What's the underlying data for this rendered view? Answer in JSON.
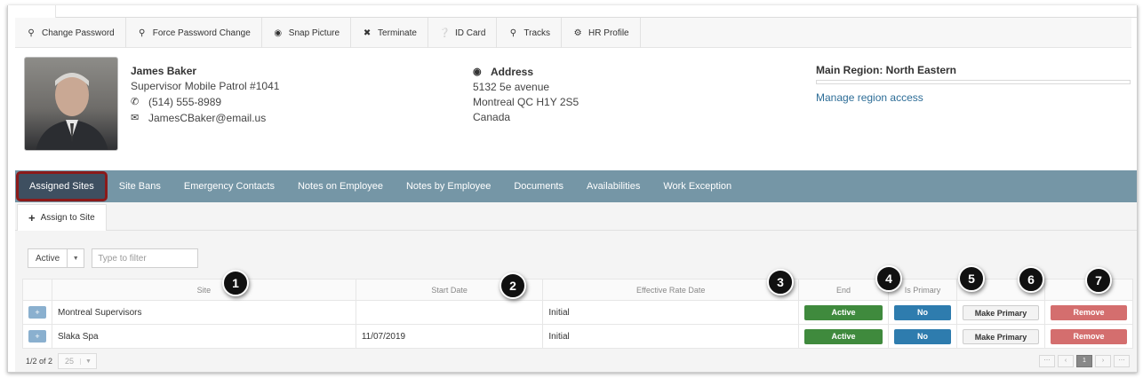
{
  "toolbar": {
    "items": [
      {
        "label": "Change Password",
        "icon": "key-icon"
      },
      {
        "label": "Force Password Change",
        "icon": "key-icon"
      },
      {
        "label": "Snap Picture",
        "icon": "camera-icon"
      },
      {
        "label": "Terminate",
        "icon": "close-icon"
      },
      {
        "label": "ID Card",
        "icon": "info-icon"
      },
      {
        "label": "Tracks",
        "icon": "map-pin-icon"
      },
      {
        "label": "HR Profile",
        "icon": "gear-icon"
      }
    ]
  },
  "employee": {
    "name": "James Baker",
    "title": "Supervisor Mobile Patrol #1041",
    "phone": "(514) 555-8989",
    "email": "JamesCBaker@email.us"
  },
  "address": {
    "heading": "Address",
    "line1": "5132 5e avenue",
    "line2": "Montreal QC H1Y 2S5",
    "line3": "Canada"
  },
  "region": {
    "main": "Main Region: North Eastern",
    "manage_link": "Manage region access"
  },
  "nav": {
    "tabs": [
      {
        "label": "Assigned Sites",
        "active": true
      },
      {
        "label": "Site Bans"
      },
      {
        "label": "Emergency Contacts"
      },
      {
        "label": "Notes on Employee"
      },
      {
        "label": "Notes by Employee"
      },
      {
        "label": "Documents"
      },
      {
        "label": "Availabilities"
      },
      {
        "label": "Work Exception"
      }
    ],
    "active_highlight_color": "#8b1a1a"
  },
  "subtab": {
    "label": "Assign to Site"
  },
  "filter": {
    "status_value": "Active",
    "placeholder": "Type to filter"
  },
  "table": {
    "columns": [
      "Site",
      "Start Date",
      "Effective Rate Date",
      "End",
      "Is Primary",
      "",
      ""
    ],
    "rows": [
      {
        "site": "Montreal Supervisors",
        "start": "",
        "rate": "Initial",
        "end": "Active",
        "primary": "No",
        "make_primary": "Make Primary",
        "remove": "Remove"
      },
      {
        "site": "Slaka Spa",
        "start": "11/07/2019",
        "rate": "Initial",
        "end": "Active",
        "primary": "No",
        "make_primary": "Make Primary",
        "remove": "Remove"
      }
    ]
  },
  "pager": {
    "summary": "1/2 of 2",
    "page_size": "25",
    "current_page": "1"
  },
  "callouts": [
    "1",
    "2",
    "3",
    "4",
    "5",
    "6",
    "7"
  ]
}
